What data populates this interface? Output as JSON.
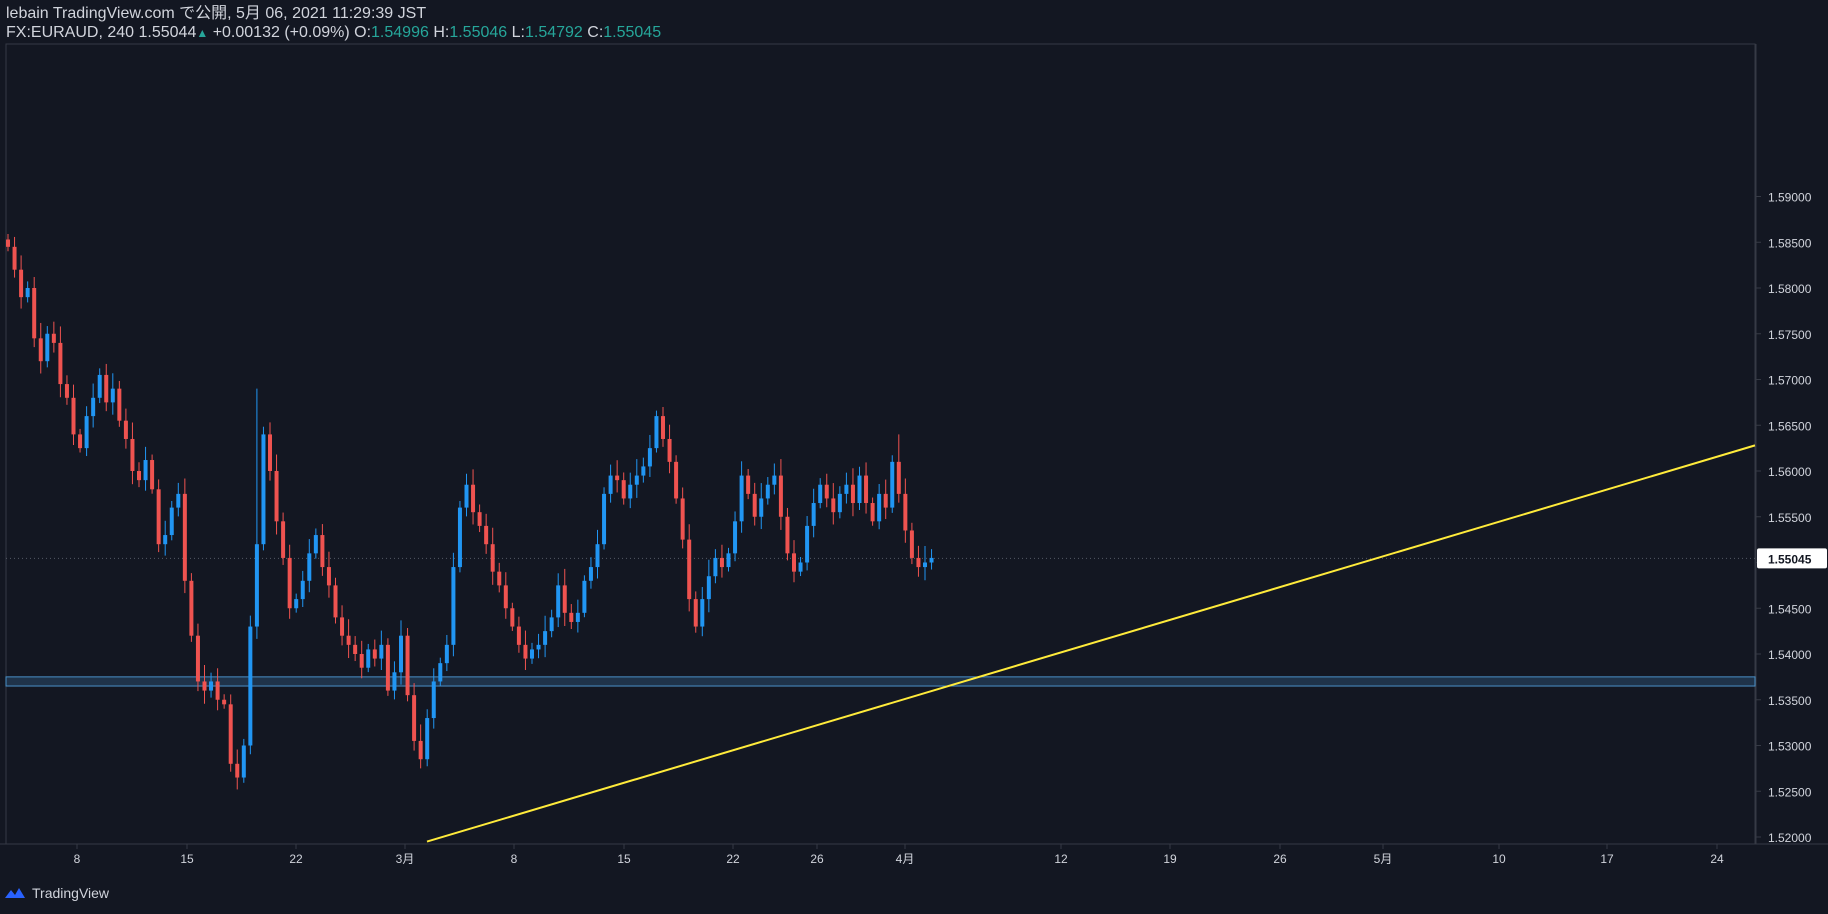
{
  "header": {
    "publish_line": "lebain TradingView.com で公開, 5月 06, 2021 11:29:39 JST",
    "symbol": "FX:EURAUD, 240",
    "last_price": "1.55044",
    "change": "+0.00132 (+0.09%)",
    "open_label": "O:",
    "open_value": "1.54996",
    "high_label": "H:",
    "high_value": "1.55046",
    "low_label": "L:",
    "low_value": "1.54792",
    "close_label": "C:",
    "close_value": "1.55045"
  },
  "footer": {
    "brand": "TradingView",
    "logo_icon": "tradingview-logo-icon"
  },
  "colors": {
    "background": "#131722",
    "bull": "#2196f3",
    "bear": "#ef5350",
    "trendline": "#ffeb3b",
    "zone": "#2a4a6b",
    "zone_border": "#4a90c8",
    "text": "#d1d4dc",
    "border": "#363a45",
    "price_tag": "#ffffff"
  },
  "chart_data": {
    "type": "candlestick",
    "symbol": "FX:EURAUD",
    "timeframe": "240",
    "ylim": [
      1.5195,
      1.5918
    ],
    "y_ticks": [
      "1.52000",
      "1.52500",
      "1.53000",
      "1.53500",
      "1.54000",
      "1.54500",
      "1.55000",
      "1.55500",
      "1.56000",
      "1.56500",
      "1.57000",
      "1.57500",
      "1.58000",
      "1.58500",
      "1.59000"
    ],
    "x_tick_labels": [
      "8",
      "15",
      "22",
      "3月",
      "8",
      "15",
      "22",
      "26",
      "4月",
      "12",
      "19",
      "26",
      "5月",
      "10",
      "17",
      "24"
    ],
    "current_price": "1.55045",
    "support_zone": [
      1.5365,
      1.5375
    ],
    "trendline": {
      "from": [
        "3月 3",
        1.5195
      ],
      "to": [
        "5月 31",
        1.5628
      ]
    },
    "close_path": [
      1.5845,
      1.582,
      1.579,
      1.58,
      1.5745,
      1.572,
      1.575,
      1.574,
      1.5695,
      1.568,
      1.564,
      1.5625,
      1.566,
      1.568,
      1.5705,
      1.5675,
      1.569,
      1.5655,
      1.5635,
      1.56,
      1.559,
      1.5612,
      1.558,
      1.552,
      1.553,
      1.556,
      1.5575,
      1.548,
      1.542,
      1.537,
      1.536,
      1.537,
      1.535,
      1.5345,
      1.528,
      1.5265,
      1.53,
      1.543,
      1.552,
      1.564,
      1.56,
      1.5545,
      1.5505,
      1.545,
      1.546,
      1.548,
      1.551,
      1.553,
      1.5495,
      1.5475,
      1.544,
      1.542,
      1.541,
      1.54,
      1.5385,
      1.5405,
      1.5395,
      1.541,
      1.536,
      1.538,
      1.542,
      1.5355,
      1.5305,
      1.5285,
      1.533,
      1.537,
      1.539,
      1.541,
      1.5495,
      1.556,
      1.5585,
      1.5555,
      1.554,
      1.552,
      1.549,
      1.5475,
      1.545,
      1.543,
      1.541,
      1.5395,
      1.5405,
      1.541,
      1.5425,
      1.544,
      1.5475,
      1.5445,
      1.5435,
      1.5445,
      1.548,
      1.5495,
      1.552,
      1.5575,
      1.5595,
      1.559,
      1.557,
      1.5585,
      1.5595,
      1.5605,
      1.5625,
      1.566,
      1.5635,
      1.561,
      1.557,
      1.5525,
      1.546,
      1.543,
      1.546,
      1.5485,
      1.5505,
      1.5495,
      1.551,
      1.5545,
      1.5595,
      1.5575,
      1.555,
      1.557,
      1.5585,
      1.5595,
      1.555,
      1.551,
      1.549,
      1.55,
      1.554,
      1.5565,
      1.5585,
      1.557,
      1.5555,
      1.5575,
      1.5585,
      1.5565,
      1.5595,
      1.5565,
      1.5545,
      1.5575,
      1.556,
      1.561,
      1.5575,
      1.5535,
      1.5505,
      1.5495,
      1.55,
      1.5505
    ],
    "high_points": [
      {
        "i": 38,
        "h": 1.569
      },
      {
        "i": 100,
        "h": 1.567
      },
      {
        "i": 136,
        "h": 1.564
      }
    ],
    "low_points": [
      {
        "i": 35,
        "h": 1.5252
      },
      {
        "i": 63,
        "h": 1.5275
      }
    ]
  }
}
